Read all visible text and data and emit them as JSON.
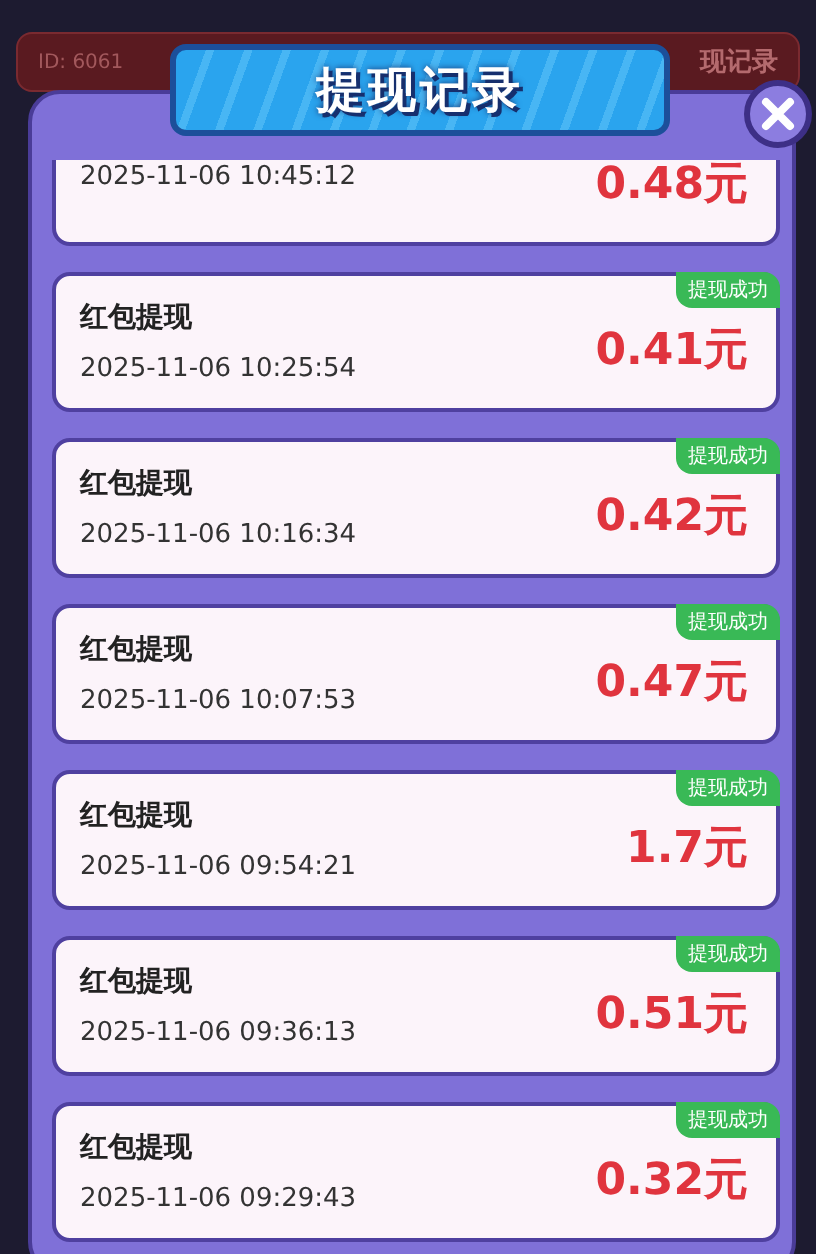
{
  "background_bar": {
    "id_text": "ID: 6061",
    "right_text": "现记录"
  },
  "dialog": {
    "title": "提现记录"
  },
  "records": [
    {
      "time": "2025-11-06 10:45:12",
      "amount": "0.48元"
    },
    {
      "title": "红包提现",
      "time": "2025-11-06 10:25:54",
      "amount": "0.41元",
      "status": "提现成功"
    },
    {
      "title": "红包提现",
      "time": "2025-11-06 10:16:34",
      "amount": "0.42元",
      "status": "提现成功"
    },
    {
      "title": "红包提现",
      "time": "2025-11-06 10:07:53",
      "amount": "0.47元",
      "status": "提现成功"
    },
    {
      "title": "红包提现",
      "time": "2025-11-06 09:54:21",
      "amount": "1.7元",
      "status": "提现成功"
    },
    {
      "title": "红包提现",
      "time": "2025-11-06 09:36:13",
      "amount": "0.51元",
      "status": "提现成功"
    },
    {
      "title": "红包提现",
      "time": "2025-11-06 09:29:43",
      "amount": "0.32元",
      "status": "提现成功"
    }
  ]
}
